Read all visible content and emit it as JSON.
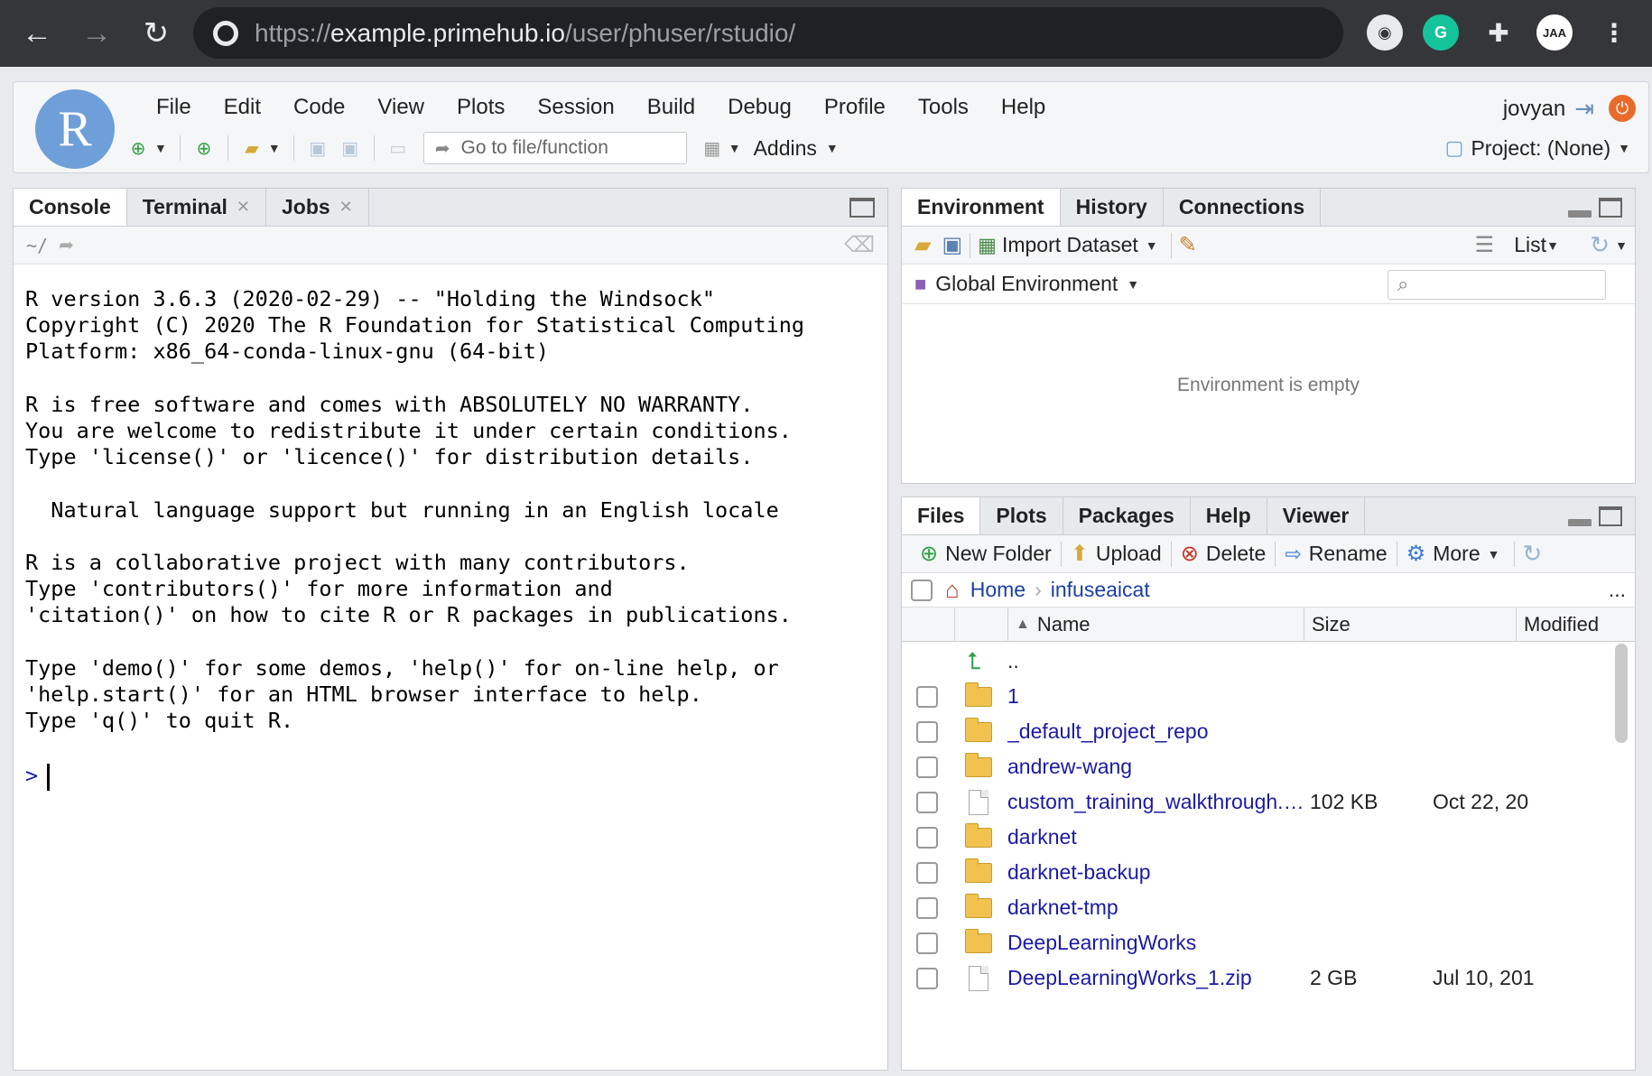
{
  "browser": {
    "url_prefix": "https://",
    "url_host": "example.primehub.io",
    "url_path": "/user/phuser/rstudio/",
    "ext_grammarly": "G",
    "ext_avatar": "JAA"
  },
  "rstudio": {
    "logo_letter": "R",
    "menu": [
      "File",
      "Edit",
      "Code",
      "View",
      "Plots",
      "Session",
      "Build",
      "Debug",
      "Profile",
      "Tools",
      "Help"
    ],
    "user": "jovyan",
    "goto_placeholder": "Go to file/function",
    "addins_label": "Addins",
    "project_label": "Project: (None)"
  },
  "console_pane": {
    "tabs": [
      {
        "label": "Console",
        "closable": false
      },
      {
        "label": "Terminal",
        "closable": true
      },
      {
        "label": "Jobs",
        "closable": true
      }
    ],
    "working_dir": "~/",
    "text": "R version 3.6.3 (2020-02-29) -- \"Holding the Windsock\"\nCopyright (C) 2020 The R Foundation for Statistical Computing\nPlatform: x86_64-conda-linux-gnu (64-bit)\n\nR is free software and comes with ABSOLUTELY NO WARRANTY.\nYou are welcome to redistribute it under certain conditions.\nType 'license()' or 'licence()' for distribution details.\n\n  Natural language support but running in an English locale\n\nR is a collaborative project with many contributors.\nType 'contributors()' for more information and\n'citation()' on how to cite R or R packages in publications.\n\nType 'demo()' for some demos, 'help()' for on-line help, or\n'help.start()' for an HTML browser interface to help.\nType 'q()' to quit R.",
    "prompt": ">"
  },
  "env_pane": {
    "tabs": [
      "Environment",
      "History",
      "Connections"
    ],
    "import_label": "Import Dataset",
    "list_label": "List",
    "scope_label": "Global Environment",
    "empty_message": "Environment is empty"
  },
  "files_pane": {
    "tabs": [
      "Files",
      "Plots",
      "Packages",
      "Help",
      "Viewer"
    ],
    "actions": {
      "new_folder": "New Folder",
      "upload": "Upload",
      "delete": "Delete",
      "rename": "Rename",
      "more": "More"
    },
    "breadcrumb": [
      "Home",
      "infuseaicat"
    ],
    "breadcrumb_more": "...",
    "columns": {
      "name": "Name",
      "size": "Size",
      "modified": "Modified"
    },
    "parent_label": "..",
    "rows": [
      {
        "name": "1",
        "type": "folder",
        "size": "",
        "modified": ""
      },
      {
        "name": "_default_project_repo",
        "type": "folder",
        "size": "",
        "modified": ""
      },
      {
        "name": "andrew-wang",
        "type": "folder",
        "size": "",
        "modified": ""
      },
      {
        "name": "custom_training_walkthrough.i…",
        "type": "file",
        "size": "102 KB",
        "modified": "Oct 22, 20"
      },
      {
        "name": "darknet",
        "type": "folder",
        "size": "",
        "modified": ""
      },
      {
        "name": "darknet-backup",
        "type": "folder",
        "size": "",
        "modified": ""
      },
      {
        "name": "darknet-tmp",
        "type": "folder",
        "size": "",
        "modified": ""
      },
      {
        "name": "DeepLearningWorks",
        "type": "folder",
        "size": "",
        "modified": ""
      },
      {
        "name": "DeepLearningWorks_1.zip",
        "type": "file",
        "size": "2 GB",
        "modified": "Jul 10, 201"
      }
    ]
  }
}
